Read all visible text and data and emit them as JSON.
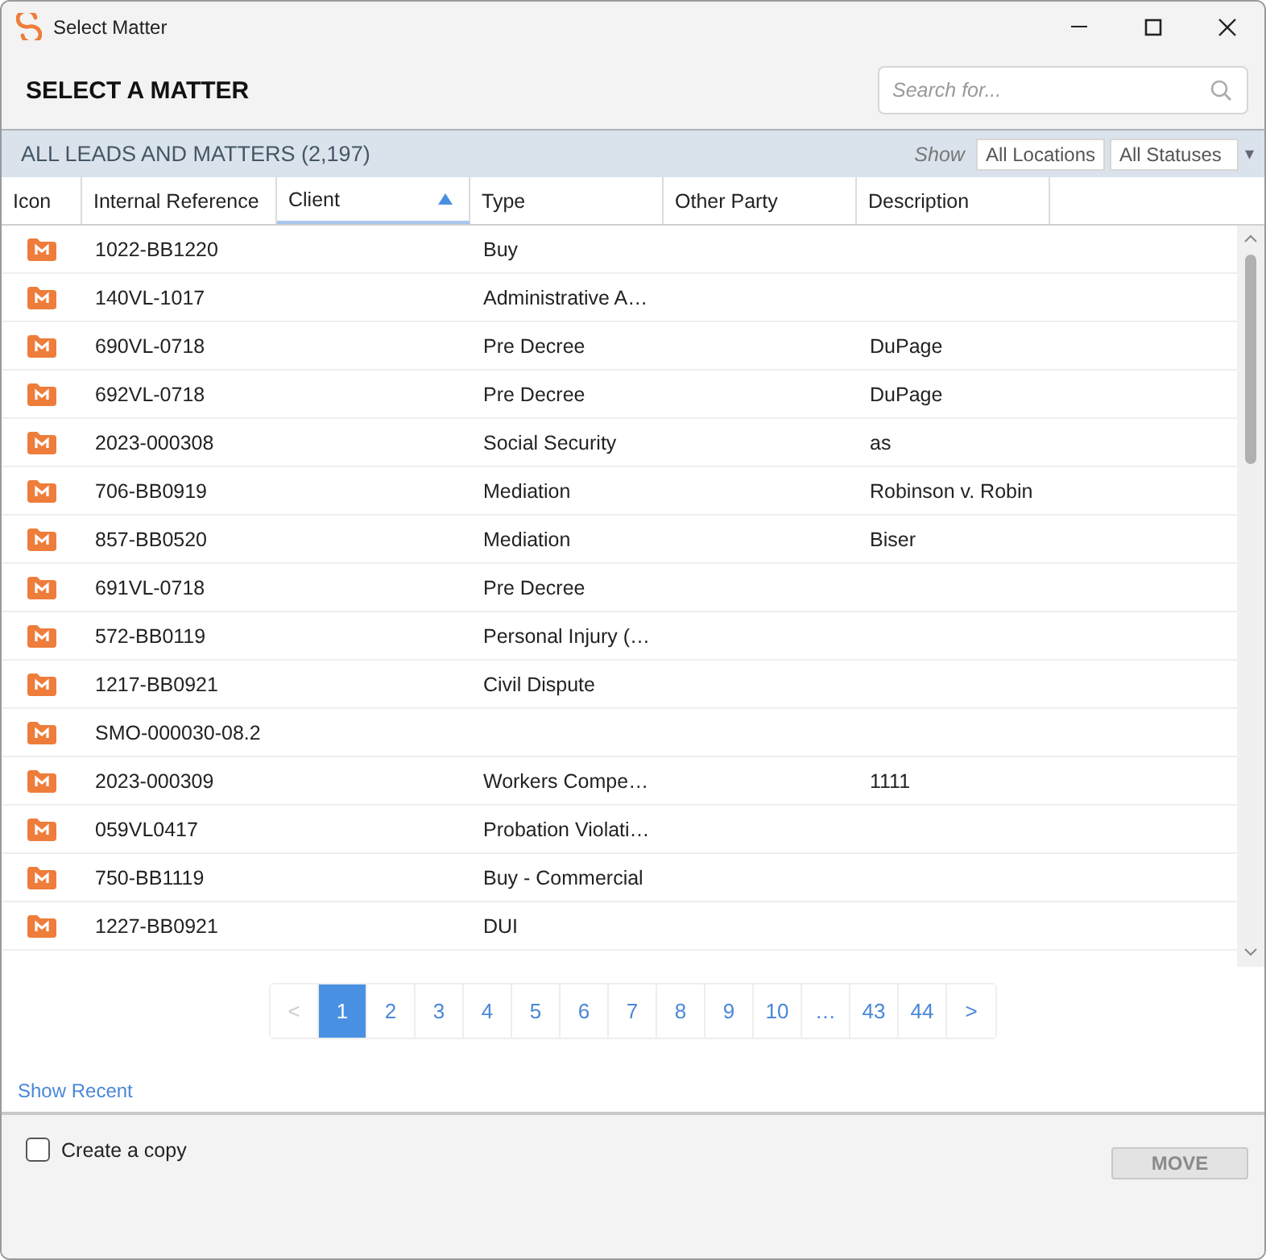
{
  "window": {
    "title": "Select Matter"
  },
  "heading": "SELECT A MATTER",
  "search": {
    "placeholder": "Search for..."
  },
  "list": {
    "title": "ALL LEADS AND MATTERS (2,197)",
    "show_label": "Show",
    "location_filter": "All Locations",
    "status_filter": "All Statuses",
    "status_caret": "▾"
  },
  "columns": [
    {
      "label": "Icon",
      "sorted": false
    },
    {
      "label": "Internal Reference",
      "sorted": false
    },
    {
      "label": "Client",
      "sorted": true
    },
    {
      "label": "Type",
      "sorted": false
    },
    {
      "label": "Other Party",
      "sorted": false
    },
    {
      "label": "Description",
      "sorted": false
    }
  ],
  "rows": [
    {
      "reference": "1022-BB1220",
      "type": "Buy"
    },
    {
      "reference": "140VL-1017",
      "type": "Administrative A…"
    },
    {
      "reference": "690VL-0718",
      "type": "Pre Decree",
      "description": "DuPage"
    },
    {
      "reference": "692VL-0718",
      "type": "Pre Decree",
      "description": "DuPage"
    },
    {
      "reference": "2023-000308",
      "type": "Social Security",
      "description": "as"
    },
    {
      "reference": "706-BB0919",
      "type": "Mediation",
      "description": "Robinson v. Robin"
    },
    {
      "reference": "857-BB0520",
      "type": "Mediation",
      "description": "Biser"
    },
    {
      "reference": "691VL-0718",
      "type": "Pre Decree"
    },
    {
      "reference": "572-BB0119",
      "type": "Personal Injury (…"
    },
    {
      "reference": "1217-BB0921",
      "type": "Civil Dispute"
    },
    {
      "reference": "SMO-000030-08.2"
    },
    {
      "reference": "2023-000309",
      "type": "Workers Compe…",
      "description": "1111"
    },
    {
      "reference": "059VL0417",
      "type": "Probation Violati…"
    },
    {
      "reference": "750-BB1119",
      "type": "Buy - Commercial"
    },
    {
      "reference": "1227-BB0921",
      "type": "DUI"
    }
  ],
  "pagination": {
    "previous": {
      "label": "<",
      "disabled": true
    },
    "pages": [
      {
        "label": "1",
        "selected": true
      },
      {
        "label": "2",
        "selected": false
      },
      {
        "label": "3",
        "selected": false
      },
      {
        "label": "4",
        "selected": false
      },
      {
        "label": "5",
        "selected": false
      },
      {
        "label": "6",
        "selected": false
      },
      {
        "label": "7",
        "selected": false
      },
      {
        "label": "8",
        "selected": false
      },
      {
        "label": "9",
        "selected": false
      },
      {
        "label": "10",
        "selected": false
      },
      {
        "label": "…",
        "selected": false
      },
      {
        "label": "43",
        "selected": false
      },
      {
        "label": "44",
        "selected": false
      }
    ],
    "next": {
      "label": ">",
      "disabled": false
    }
  },
  "show_recent": "Show Recent",
  "create_copy": {
    "label": "Create a copy",
    "checked": false
  },
  "move_button": {
    "label": "MOVE",
    "disabled": true
  }
}
